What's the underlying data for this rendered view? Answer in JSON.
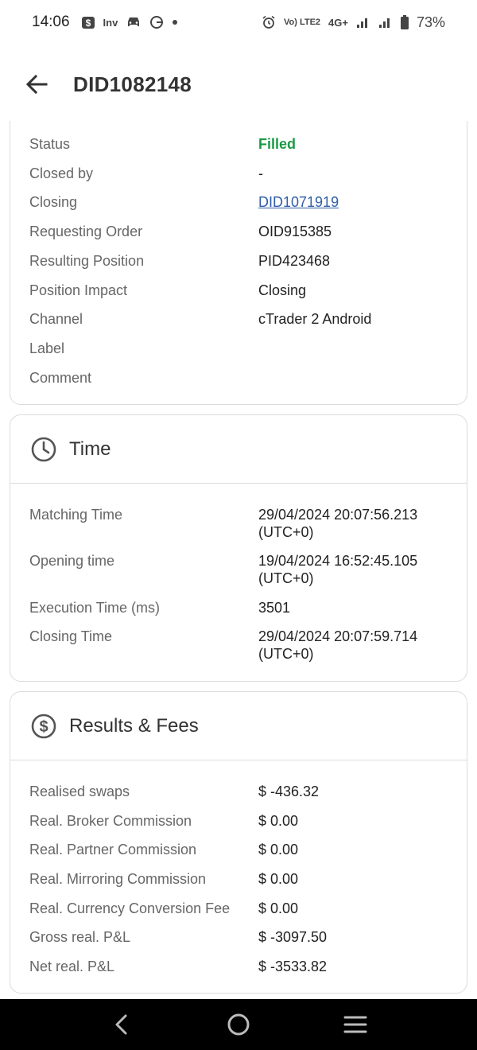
{
  "status_bar": {
    "time": "14:06",
    "left_icons": [
      "dollar-notification-icon",
      "inv-notification-icon",
      "car-icon",
      "g-icon",
      "dot-icon"
    ],
    "inv_text": "Inv",
    "g_text": "G",
    "volte_text": "Vo) LTE2",
    "network_text": "4G+",
    "battery_text": "73%"
  },
  "header": {
    "title": "DID1082148",
    "back_icon": "arrow-left-icon"
  },
  "details": {
    "rows": [
      {
        "label": "Status",
        "value": "Filled",
        "value_color": "#1a9a44"
      },
      {
        "label": "Closed by",
        "value": "-"
      },
      {
        "label": "Closing",
        "value": "DID1071919",
        "is_link": true
      },
      {
        "label": "Requesting Order",
        "value": "OID915385"
      },
      {
        "label": "Resulting Position",
        "value": "PID423468"
      },
      {
        "label": "Position Impact",
        "value": "Closing"
      },
      {
        "label": "Channel",
        "value": "cTrader 2 Android"
      },
      {
        "label": "Label",
        "value": ""
      },
      {
        "label": "Comment",
        "value": ""
      }
    ]
  },
  "time_card": {
    "title": "Time",
    "icon": "clock-icon",
    "rows": [
      {
        "label": "Matching Time",
        "value": "29/04/2024 20:07:56.213",
        "value2": "(UTC+0)"
      },
      {
        "label": "Opening time",
        "value": "19/04/2024 16:52:45.105",
        "value2": "(UTC+0)"
      },
      {
        "label": "Execution Time (ms)",
        "value": "3501"
      },
      {
        "label": "Closing Time",
        "value": "29/04/2024 20:07:59.714",
        "value2": "(UTC+0)"
      }
    ]
  },
  "fees_card": {
    "title": "Results & Fees",
    "icon": "dollar-circle-icon",
    "rows": [
      {
        "label": "Realised swaps",
        "value": "$ -436.32"
      },
      {
        "label": "Real. Broker Commission",
        "value": "$ 0.00"
      },
      {
        "label": "Real. Partner Commission",
        "value": "$ 0.00"
      },
      {
        "label": "Real. Mirroring Commission",
        "value": "$ 0.00"
      },
      {
        "label": "Real. Currency Conversion Fee",
        "value": "$ 0.00"
      },
      {
        "label": "Gross real. P&L",
        "value": "$ -3097.50"
      },
      {
        "label": "Net real. P&L",
        "value": "$ -3533.82"
      }
    ]
  },
  "nav_bar": {
    "buttons": [
      "back-nav-icon",
      "home-nav-icon",
      "recents-nav-icon"
    ]
  }
}
